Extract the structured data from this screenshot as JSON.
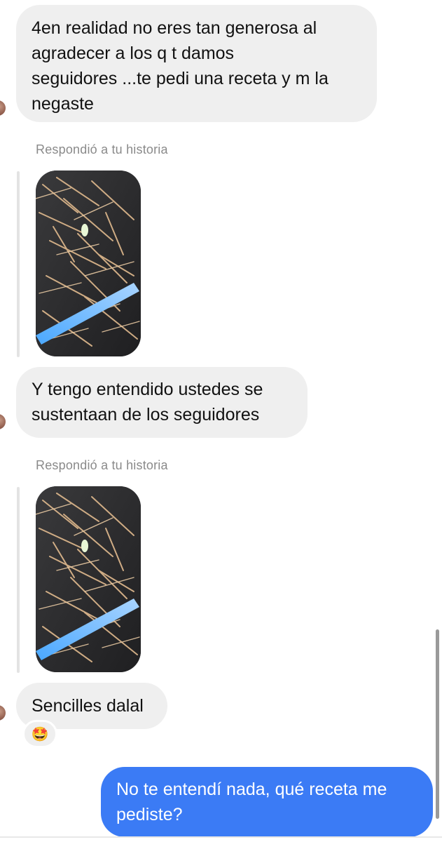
{
  "thread": {
    "message_1": {
      "line_1": "4en realidad no eres tan generosa al",
      "line_2": "agradecer a los q t damos",
      "line_3": "seguidores ...te pedi una receta y m la",
      "line_4": "negaste"
    },
    "reply_label_1": "Respondió a tu historia",
    "message_2": {
      "line_1": "Y tengo entendido ustedes se",
      "line_2": "sustentaan de los seguidores"
    },
    "reply_label_2": "Respondió a tu historia",
    "message_3": {
      "line_1": "Sencilles dalal"
    },
    "reaction": {
      "emoji": "🤩",
      "icon": "star-struck-emoji-icon"
    },
    "outgoing_message": {
      "line_1": "No te entendí nada, qué receta me",
      "line_2": "pediste?"
    }
  },
  "colors": {
    "incoming_bubble": "#efefef",
    "outgoing_bubble": "#3b7bf5",
    "label_gray": "#8a8a8a"
  }
}
